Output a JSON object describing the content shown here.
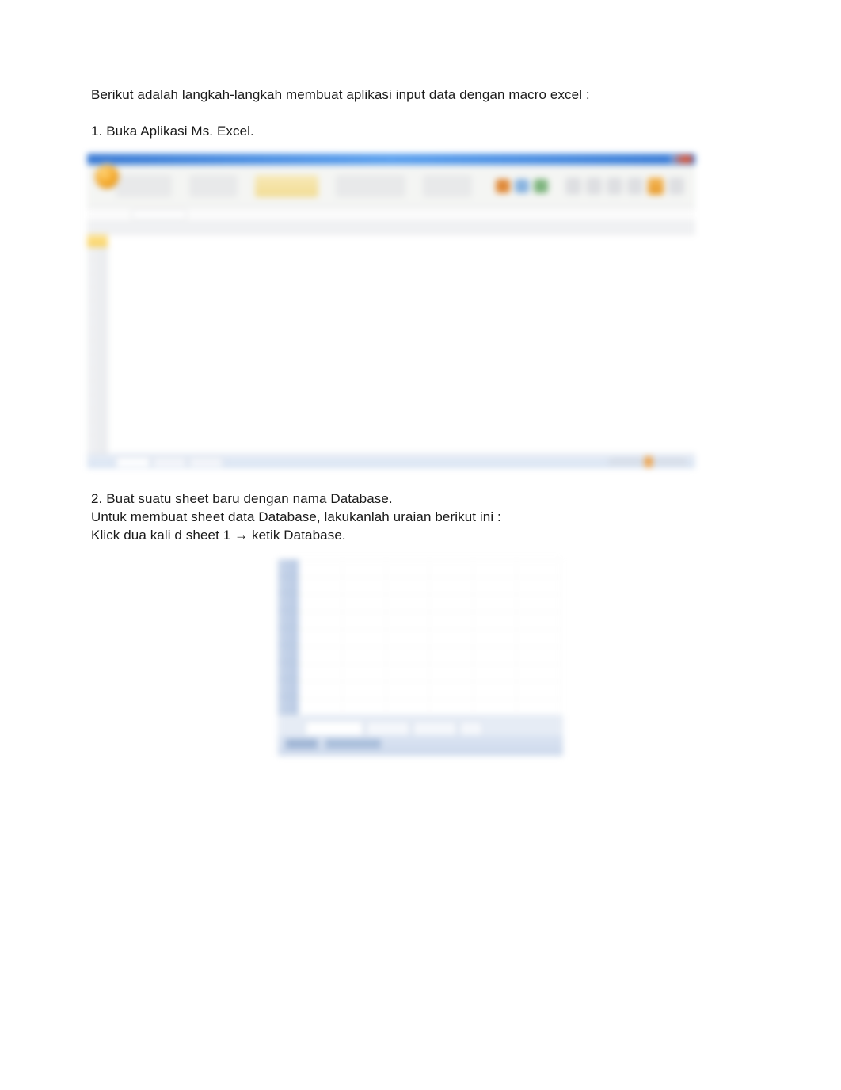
{
  "intro": "Berikut adalah langkah-langkah membuat aplikasi input data dengan macro excel :",
  "step1": "1. Buka Aplikasi Ms. Excel.",
  "step2": {
    "line1": "2. Buat suatu sheet baru dengan nama Database.",
    "line2": "Untuk membuat sheet data Database, lakukanlah uraian berikut ini :",
    "line3": "Klick dua kali d sheet 1 → ketik Database."
  }
}
